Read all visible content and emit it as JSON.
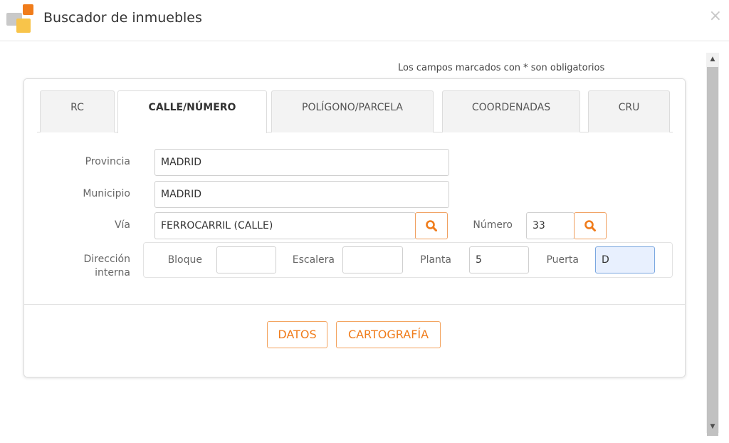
{
  "header": {
    "title": "Buscador de inmuebles",
    "close_symbol": "×"
  },
  "required_note": "Los campos marcados con * son obligatorios",
  "tabs": [
    {
      "label": "RC",
      "active": false
    },
    {
      "label": "CALLE/NÚMERO",
      "active": true
    },
    {
      "label": "POLÍGONO/PARCELA",
      "active": false
    },
    {
      "label": "COORDENADAS",
      "active": false
    },
    {
      "label": "CRU",
      "active": false
    }
  ],
  "form": {
    "provincia": {
      "label": "Provincia",
      "value": "MADRID"
    },
    "municipio": {
      "label": "Municipio",
      "value": "MADRID"
    },
    "via": {
      "label": "Vía",
      "value": "FERROCARRIL (CALLE)"
    },
    "numero": {
      "label": "Número",
      "value": "33"
    },
    "direccion_interna": {
      "label_line1": "Dirección",
      "label_line2": "interna",
      "bloque": {
        "label": "Bloque",
        "value": ""
      },
      "escalera": {
        "label": "Escalera",
        "value": ""
      },
      "planta": {
        "label": "Planta",
        "value": "5"
      },
      "puerta": {
        "label": "Puerta",
        "value": "D"
      }
    }
  },
  "buttons": {
    "datos": "DATOS",
    "cartografia": "CARTOGRAFÍA"
  },
  "colors": {
    "accent": "#f07c1b",
    "focus_bg": "#e8f0fe"
  },
  "icons": {
    "search": "search-icon",
    "close": "close-icon",
    "logo": "app-logo"
  }
}
